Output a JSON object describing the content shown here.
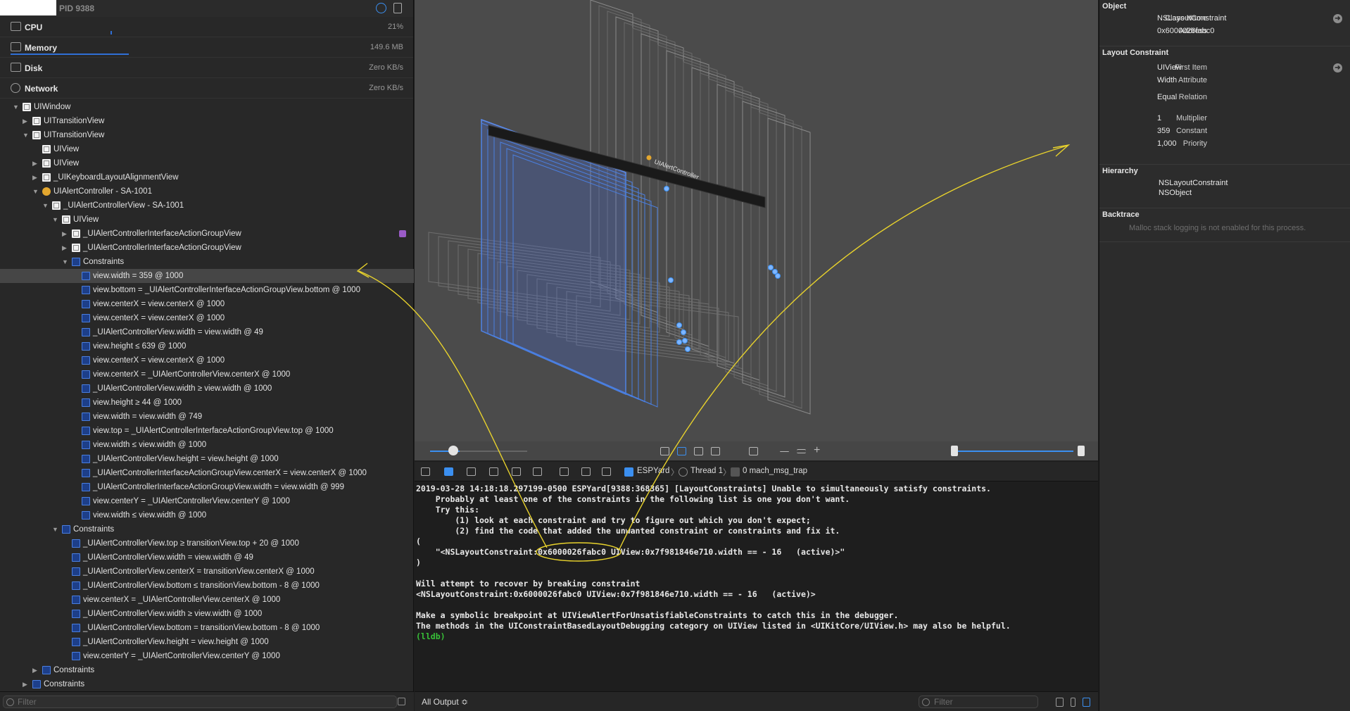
{
  "navigator": {
    "pid": "PID 9388",
    "gauges": [
      {
        "label": "CPU",
        "value": "21%",
        "icon": "cpu-icon",
        "level": 0.21
      },
      {
        "label": "Memory",
        "value": "149.6 MB",
        "icon": "memory-icon",
        "level": 0.3
      },
      {
        "label": "Disk",
        "value": "Zero KB/s",
        "icon": "disk-icon"
      },
      {
        "label": "Network",
        "value": "Zero KB/s",
        "icon": "network-icon"
      }
    ],
    "tree": [
      {
        "label": "UIWindow",
        "depth": 0,
        "disc": "open",
        "icon": "view"
      },
      {
        "label": "UITransitionView",
        "depth": 1,
        "disc": "closed",
        "icon": "view"
      },
      {
        "label": "UITransitionView",
        "depth": 1,
        "disc": "open",
        "icon": "view"
      },
      {
        "label": "UIView",
        "depth": 2,
        "disc": "none",
        "icon": "view"
      },
      {
        "label": "UIView",
        "depth": 2,
        "disc": "closed",
        "icon": "view"
      },
      {
        "label": "_UIKeyboardLayoutAlignmentView",
        "depth": 2,
        "disc": "closed",
        "icon": "view"
      },
      {
        "label": "UIAlertController - SA-1001",
        "depth": 2,
        "disc": "open",
        "icon": "controller"
      },
      {
        "label": "_UIAlertControllerView - SA-1001",
        "depth": 3,
        "disc": "open",
        "icon": "view"
      },
      {
        "label": "UIView",
        "depth": 4,
        "disc": "open",
        "icon": "view"
      },
      {
        "label": "_UIAlertControllerInterfaceActionGroupView",
        "depth": 5,
        "disc": "closed",
        "icon": "view",
        "badge": true
      },
      {
        "label": "_UIAlertControllerInterfaceActionGroupView",
        "depth": 5,
        "disc": "closed",
        "icon": "view"
      },
      {
        "label": "Constraints",
        "depth": 5,
        "disc": "open",
        "icon": "constraint"
      },
      {
        "label": "view.width = 359 @ 1000",
        "depth": 6,
        "disc": "none",
        "icon": "constraint",
        "selected": true
      },
      {
        "label": "view.bottom = _UIAlertControllerInterfaceActionGroupView.bottom @ 1000",
        "depth": 6,
        "disc": "none",
        "icon": "constraint"
      },
      {
        "label": "view.centerX = view.centerX @ 1000",
        "depth": 6,
        "disc": "none",
        "icon": "constraint"
      },
      {
        "label": "view.centerX = view.centerX @ 1000",
        "depth": 6,
        "disc": "none",
        "icon": "constraint"
      },
      {
        "label": "_UIAlertControllerView.width = view.width @ 49",
        "depth": 6,
        "disc": "none",
        "icon": "constraint"
      },
      {
        "label": "view.height ≤ 639 @ 1000",
        "depth": 6,
        "disc": "none",
        "icon": "constraint"
      },
      {
        "label": "view.centerX = view.centerX @ 1000",
        "depth": 6,
        "disc": "none",
        "icon": "constraint"
      },
      {
        "label": "view.centerX = _UIAlertControllerView.centerX @ 1000",
        "depth": 6,
        "disc": "none",
        "icon": "constraint"
      },
      {
        "label": "_UIAlertControllerView.width ≥ view.width @ 1000",
        "depth": 6,
        "disc": "none",
        "icon": "constraint"
      },
      {
        "label": "view.height ≥ 44 @ 1000",
        "depth": 6,
        "disc": "none",
        "icon": "constraint"
      },
      {
        "label": "view.width = view.width @ 749",
        "depth": 6,
        "disc": "none",
        "icon": "constraint"
      },
      {
        "label": "view.top = _UIAlertControllerInterfaceActionGroupView.top @ 1000",
        "depth": 6,
        "disc": "none",
        "icon": "constraint"
      },
      {
        "label": "view.width ≤ view.width @ 1000",
        "depth": 6,
        "disc": "none",
        "icon": "constraint"
      },
      {
        "label": "_UIAlertControllerView.height = view.height @ 1000",
        "depth": 6,
        "disc": "none",
        "icon": "constraint"
      },
      {
        "label": "_UIAlertControllerInterfaceActionGroupView.centerX = view.centerX @ 1000",
        "depth": 6,
        "disc": "none",
        "icon": "constraint"
      },
      {
        "label": "_UIAlertControllerInterfaceActionGroupView.width = view.width @ 999",
        "depth": 6,
        "disc": "none",
        "icon": "constraint"
      },
      {
        "label": "view.centerY = _UIAlertControllerView.centerY @ 1000",
        "depth": 6,
        "disc": "none",
        "icon": "constraint"
      },
      {
        "label": "view.width ≤ view.width @ 1000",
        "depth": 6,
        "disc": "none",
        "icon": "constraint"
      },
      {
        "label": "Constraints",
        "depth": 4,
        "disc": "open",
        "icon": "constraint"
      },
      {
        "label": "_UIAlertControllerView.top ≥ transitionView.top + 20 @ 1000",
        "depth": 5,
        "disc": "none",
        "icon": "constraint"
      },
      {
        "label": "_UIAlertControllerView.width = view.width @ 49",
        "depth": 5,
        "disc": "none",
        "icon": "constraint"
      },
      {
        "label": "_UIAlertControllerView.centerX = transitionView.centerX @ 1000",
        "depth": 5,
        "disc": "none",
        "icon": "constraint"
      },
      {
        "label": "_UIAlertControllerView.bottom ≤ transitionView.bottom - 8 @ 1000",
        "depth": 5,
        "disc": "none",
        "icon": "constraint"
      },
      {
        "label": "view.centerX = _UIAlertControllerView.centerX @ 1000",
        "depth": 5,
        "disc": "none",
        "icon": "constraint"
      },
      {
        "label": "_UIAlertControllerView.width ≥ view.width @ 1000",
        "depth": 5,
        "disc": "none",
        "icon": "constraint"
      },
      {
        "label": "_UIAlertControllerView.bottom = transitionView.bottom - 8 @ 1000",
        "depth": 5,
        "disc": "none",
        "icon": "constraint"
      },
      {
        "label": "_UIAlertControllerView.height = view.height @ 1000",
        "depth": 5,
        "disc": "none",
        "icon": "constraint"
      },
      {
        "label": "view.centerY = _UIAlertControllerView.centerY @ 1000",
        "depth": 5,
        "disc": "none",
        "icon": "constraint"
      },
      {
        "label": "Constraints",
        "depth": 2,
        "disc": "closed",
        "icon": "constraint"
      },
      {
        "label": "Constraints",
        "depth": 1,
        "disc": "closed",
        "icon": "constraint"
      }
    ],
    "filter_placeholder": "Filter"
  },
  "canvas": {
    "alert_label": "UIAlertController"
  },
  "debugbar": {
    "process": "ESPYard",
    "thread": "Thread 1",
    "frame": "0 mach_msg_trap"
  },
  "console": {
    "lines": [
      "2019-03-28 14:18:18.297199-0500 ESPYard[9388:368365] [LayoutConstraints] Unable to simultaneously satisfy constraints.",
      "    Probably at least one of the constraints in the following list is one you don't want.",
      "    Try this:",
      "        (1) look at each constraint and try to figure out which you don't expect;",
      "        (2) find the code that added the unwanted constraint or constraints and fix it.",
      "(",
      "    \"<NSLayoutConstraint:0x6000026fabc0 UIView:0x7f981846e710.width == - 16   (active)>\"",
      ")",
      "",
      "Will attempt to recover by breaking constraint",
      "<NSLayoutConstraint:0x6000026fabc0 UIView:0x7f981846e710.width == - 16   (active)>",
      "",
      "Make a symbolic breakpoint at UIViewAlertForUnsatisfiableConstraints to catch this in the debugger.",
      "The methods in the UIConstraintBasedLayoutDebugging category on UIView listed in <UIKitCore/UIView.h> may also be helpful."
    ],
    "prompt": "(lldb)",
    "output_selector": "All Output ≎",
    "filter_placeholder": "Filter"
  },
  "inspector": {
    "object": {
      "title": "Object",
      "class_name_key": "Class Name",
      "class_name": "NSLayoutConstraint",
      "address_key": "Address",
      "address": "0x6000026fabc0"
    },
    "constraint": {
      "title": "Layout Constraint",
      "first_item_key": "First Item",
      "first_item": "UIView",
      "attribute_key": "Attribute",
      "attribute": "Width",
      "relation_key": "Relation",
      "relation": "Equal",
      "multiplier_key": "Multiplier",
      "multiplier": "1",
      "constant_key": "Constant",
      "constant": "359",
      "priority_key": "Priority",
      "priority": "1,000"
    },
    "hierarchy": {
      "title": "Hierarchy",
      "items": [
        "NSLayoutConstraint",
        "NSObject"
      ]
    },
    "backtrace": {
      "title": "Backtrace",
      "message": "Malloc stack logging is not enabled for this process."
    }
  },
  "colors": {
    "accent": "#3b8ff0",
    "prompt": "#38c138",
    "annotation": "#e8d22c"
  }
}
